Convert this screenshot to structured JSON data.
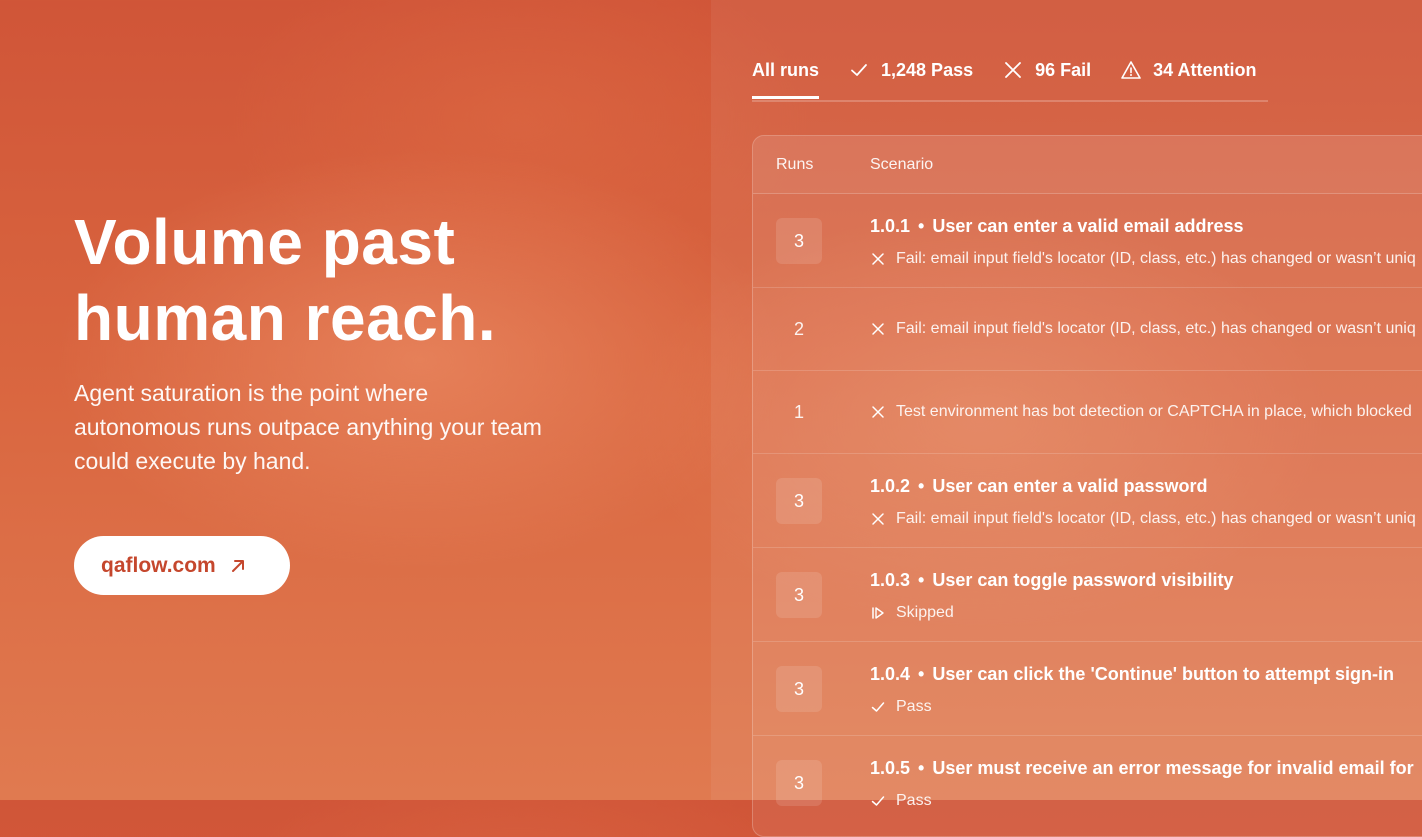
{
  "hero": {
    "headline_line1": "Volume past",
    "headline_line2": "human reach.",
    "subtext": "Agent saturation is the point where autonomous runs outpace anything your team could execute by hand.",
    "cta_label": "qaflow.com",
    "cta_icon": "arrow-up-right-icon"
  },
  "tabs": {
    "all": "All runs",
    "pass": "1,248 Pass",
    "fail": "96 Fail",
    "attention": "34 Attention"
  },
  "table": {
    "col_runs": "Runs",
    "col_scenario": "Scenario",
    "rows": [
      {
        "runs": "3",
        "id": "1.0.1",
        "title": "User can enter a valid email address",
        "status": "Fail: email input field's locator (ID, class, etc.) has changed or wasn’t uniq",
        "status_type": "fail"
      },
      {
        "runs": "2",
        "status": "Fail: email input field's locator (ID, class, etc.) has changed or wasn’t uniq",
        "status_type": "fail"
      },
      {
        "runs": "1",
        "status": "Test environment has bot detection or CAPTCHA in place, which blocked",
        "status_type": "fail"
      },
      {
        "runs": "3",
        "id": "1.0.2",
        "title": "User can enter a valid password",
        "status": "Fail: email input field's locator (ID, class, etc.) has changed or wasn’t uniq",
        "status_type": "fail"
      },
      {
        "runs": "3",
        "id": "1.0.3",
        "title": "User can toggle password visibility",
        "status": "Skipped",
        "status_type": "skipped"
      },
      {
        "runs": "3",
        "id": "1.0.4",
        "title": "User can click the 'Continue' button to attempt sign-in",
        "status": "Pass",
        "status_type": "pass"
      },
      {
        "runs": "3",
        "id": "1.0.5",
        "title": "User must receive an error message for invalid email for",
        "status": "Pass",
        "status_type": "pass"
      }
    ]
  }
}
